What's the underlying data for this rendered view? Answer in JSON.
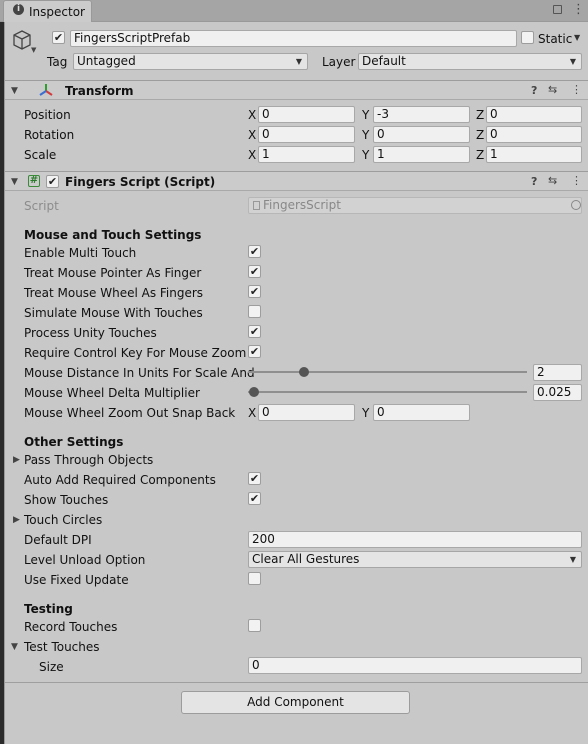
{
  "tab": {
    "title": "Inspector",
    "icon": "info-icon",
    "lock_icon": "lock-icon",
    "menu_icon": "kebab-menu-icon"
  },
  "object": {
    "active": true,
    "name": "FingersScriptPrefab",
    "static_label": "Static",
    "static_checked": false,
    "tag_label": "Tag",
    "tag_value": "Untagged",
    "layer_label": "Layer",
    "layer_value": "Default"
  },
  "transform": {
    "title": "Transform",
    "rows": [
      {
        "label": "Position",
        "x": "0",
        "y": "-3",
        "z": "0"
      },
      {
        "label": "Rotation",
        "x": "0",
        "y": "0",
        "z": "0"
      },
      {
        "label": "Scale",
        "x": "1",
        "y": "1",
        "z": "1"
      }
    ],
    "axis": {
      "x": "X",
      "y": "Y",
      "z": "Z"
    }
  },
  "fingers": {
    "title": "Fingers Script (Script)",
    "enabled": true,
    "script_label": "Script",
    "script_value": "FingersScript",
    "mouse_section": "Mouse and Touch Settings",
    "enable_multi_touch": {
      "label": "Enable Multi Touch",
      "checked": true
    },
    "treat_mouse_pointer": {
      "label": "Treat Mouse Pointer As Finger",
      "checked": true
    },
    "treat_mouse_wheel": {
      "label": "Treat Mouse Wheel As Fingers",
      "checked": true
    },
    "simulate_mouse": {
      "label": "Simulate Mouse With Touches",
      "checked": false
    },
    "process_unity": {
      "label": "Process Unity Touches",
      "checked": true
    },
    "require_control": {
      "label": "Require Control Key For Mouse Zoom",
      "checked": true
    },
    "mouse_distance": {
      "label": "Mouse Distance In Units For Scale And",
      "value": "2",
      "fraction": 0.2
    },
    "wheel_delta": {
      "label": "Mouse Wheel Delta Multiplier",
      "value": "0.025",
      "fraction": 0.02
    },
    "zoom_snap": {
      "label": "Mouse Wheel Zoom Out Snap Back",
      "x": "0",
      "y": "0"
    },
    "other_section": "Other Settings",
    "pass_through": {
      "label": "Pass Through Objects"
    },
    "auto_add": {
      "label": "Auto Add Required Components",
      "checked": true
    },
    "show_touches": {
      "label": "Show Touches",
      "checked": true
    },
    "touch_circles": {
      "label": "Touch Circles"
    },
    "default_dpi": {
      "label": "Default DPI",
      "value": "200"
    },
    "level_unload": {
      "label": "Level Unload Option",
      "value": "Clear All Gestures"
    },
    "fixed_update": {
      "label": "Use Fixed Update",
      "checked": false
    },
    "testing_section": "Testing",
    "record_touches": {
      "label": "Record Touches",
      "checked": false
    },
    "test_touches": {
      "label": "Test Touches",
      "size_label": "Size",
      "size_value": "0"
    }
  },
  "add_component": "Add Component",
  "glyphs": {
    "check": "✔",
    "arrow_down": "▼",
    "arrow_right": "▶",
    "help": "?",
    "settings": "⇆",
    "more": "⋮",
    "hash": "#"
  }
}
